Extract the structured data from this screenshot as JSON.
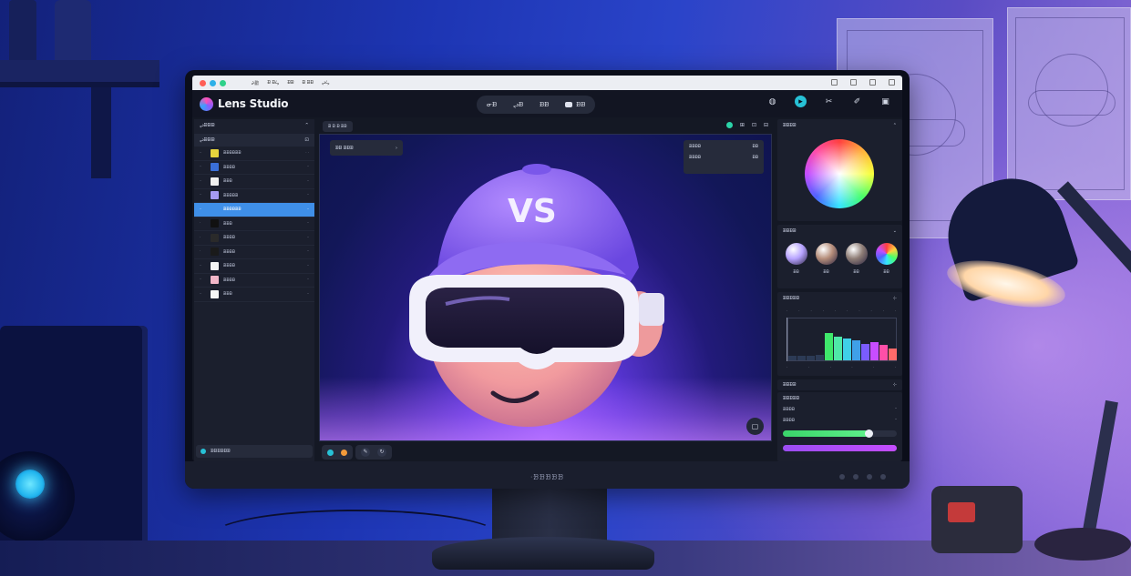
{
  "window": {
    "menu": [
      "ᖨ歗",
      "ᗿ ᗿᖥ",
      "ᗿᗿ",
      "ᗿ ᗿᗿ",
      "ᖢᖥ"
    ]
  },
  "app": {
    "name": "Lens Studio",
    "modes": [
      {
        "label": "ᓂᗿ",
        "icon": "none"
      },
      {
        "label": "ᖢᗿ",
        "icon": "none"
      },
      {
        "label": "ᗿᗿ",
        "icon": "none"
      },
      {
        "label": "ᗿᗿ",
        "icon": "camera-icon"
      }
    ],
    "accent": "#27c1d6",
    "selection_color": "#3f8fe8"
  },
  "left_panel": {
    "title": "ᖢᗿᗿᗿ",
    "subtitle": "ᖢᗿᗿᗿ",
    "rows": [
      {
        "num": "ᐧᐧ",
        "label": "ᗿᗿᗿᗿᗿᗿ",
        "meta": "ᐧ ᐧ",
        "color": "#e6d33d"
      },
      {
        "num": "ᐧᐧ",
        "label": "ᗿᗿᗿᗿ",
        "meta": "ᐧᐧ",
        "color": "#3a6fd8"
      },
      {
        "num": "ᐧᐧ",
        "label": "ᗿᗿᗿ",
        "meta": "ᐧᐧ",
        "color": "#f0f0f0"
      },
      {
        "num": "ᐧᐧ",
        "label": "ᗿᗿᗿᗿᗿ",
        "meta": "ᐧᐧ",
        "color": "#a69bf2"
      },
      {
        "num": "ᐧᐧ",
        "label": "ᗿᗿᗿᗿᗿᗿ",
        "meta": "ᐧᐧ",
        "color": "#3f8fe8",
        "selected": true
      },
      {
        "num": "ᐧ",
        "label": "ᗿᗿᗿ",
        "meta": "ᐧᐧ",
        "color": "#111111"
      },
      {
        "num": "ᐧ",
        "label": "ᗿᗿᗿᗿ",
        "meta": "ᐧᐧ",
        "color": "#2a2a2a"
      },
      {
        "num": "ᐧ",
        "label": "ᗿᗿᗿᗿ",
        "meta": "ᐧᐧ",
        "color": "#1a1a1a"
      },
      {
        "num": "ᐧᐧ",
        "label": "ᗿᗿᗿᗿ",
        "meta": "ᐧᐧ",
        "color": "#f5f5f5"
      },
      {
        "num": "ᐧᐧ",
        "label": "ᗿᗿᗿᗿ",
        "meta": "ᐧᐧ",
        "color": "#f1b6c8"
      },
      {
        "num": "ᐧᐧ",
        "label": "ᗿᗿᗿ",
        "meta": "ᐧᐧ",
        "color": "#f5f5f5"
      }
    ],
    "footer": "ᗿᗿᗿᗿᗿᗿ"
  },
  "viewport": {
    "toolbar_chip": "ᗿ ᗿ ᗿ ᗿᗿ",
    "scene_chip": "ᗿᗿ ᗿᗿᗿ",
    "info": [
      {
        "k": "ᗿᗿᗿᗿ",
        "v": "ᗿᗿ"
      },
      {
        "k": "ᗿᗿᗿᗿ",
        "v": "ᗿᗿ"
      }
    ],
    "cap_logo": "VS"
  },
  "right_panel": {
    "color_title": "ᗿᗿᗿᗿ",
    "materials_title": "ᗿᗿᗿᗿ",
    "materials": [
      {
        "label": "ᗿᗿ",
        "color": "#b7a3ff"
      },
      {
        "label": "ᗿᗿ",
        "color": "#b58d7a"
      },
      {
        "label": "ᗿᗿ",
        "color": "#8e7d76"
      },
      {
        "label": "ᗿᗿ",
        "color": "rainbow"
      }
    ],
    "histogram_title": "ᗿᗿᗿᗿᗿ",
    "histogram_bars": [
      {
        "value": 0.1,
        "color": "#2c3a55"
      },
      {
        "value": 0.1,
        "color": "#2c3a55"
      },
      {
        "value": 0.1,
        "color": "#2c3a55"
      },
      {
        "value": 0.12,
        "color": "#2c3a55"
      },
      {
        "value": 0.62,
        "color": "#3fe86b"
      },
      {
        "value": 0.55,
        "color": "#4fe8a8"
      },
      {
        "value": 0.5,
        "color": "#3fd0e8"
      },
      {
        "value": 0.45,
        "color": "#3fa0e8"
      },
      {
        "value": 0.38,
        "color": "#7a5cff"
      },
      {
        "value": 0.42,
        "color": "#c84dff"
      },
      {
        "value": 0.35,
        "color": "#ff4fa8"
      },
      {
        "value": 0.28,
        "color": "#ff6a6a"
      }
    ],
    "properties_title": "ᗿᗿᗿᗿ",
    "properties_subtitle": "ᗿᗿᗿᗿᗿ",
    "props": [
      {
        "k": "ᗿᗿᗿᗿ",
        "v": "ᐧᐧ"
      },
      {
        "k": "ᗿᗿᗿᗿ",
        "v": "ᐧᐧ"
      }
    ],
    "slider_green": 0.75,
    "slider_purple": 1.0
  },
  "monitor": {
    "brand": "ᐧᗿᗿᗿᗿᗿ"
  }
}
